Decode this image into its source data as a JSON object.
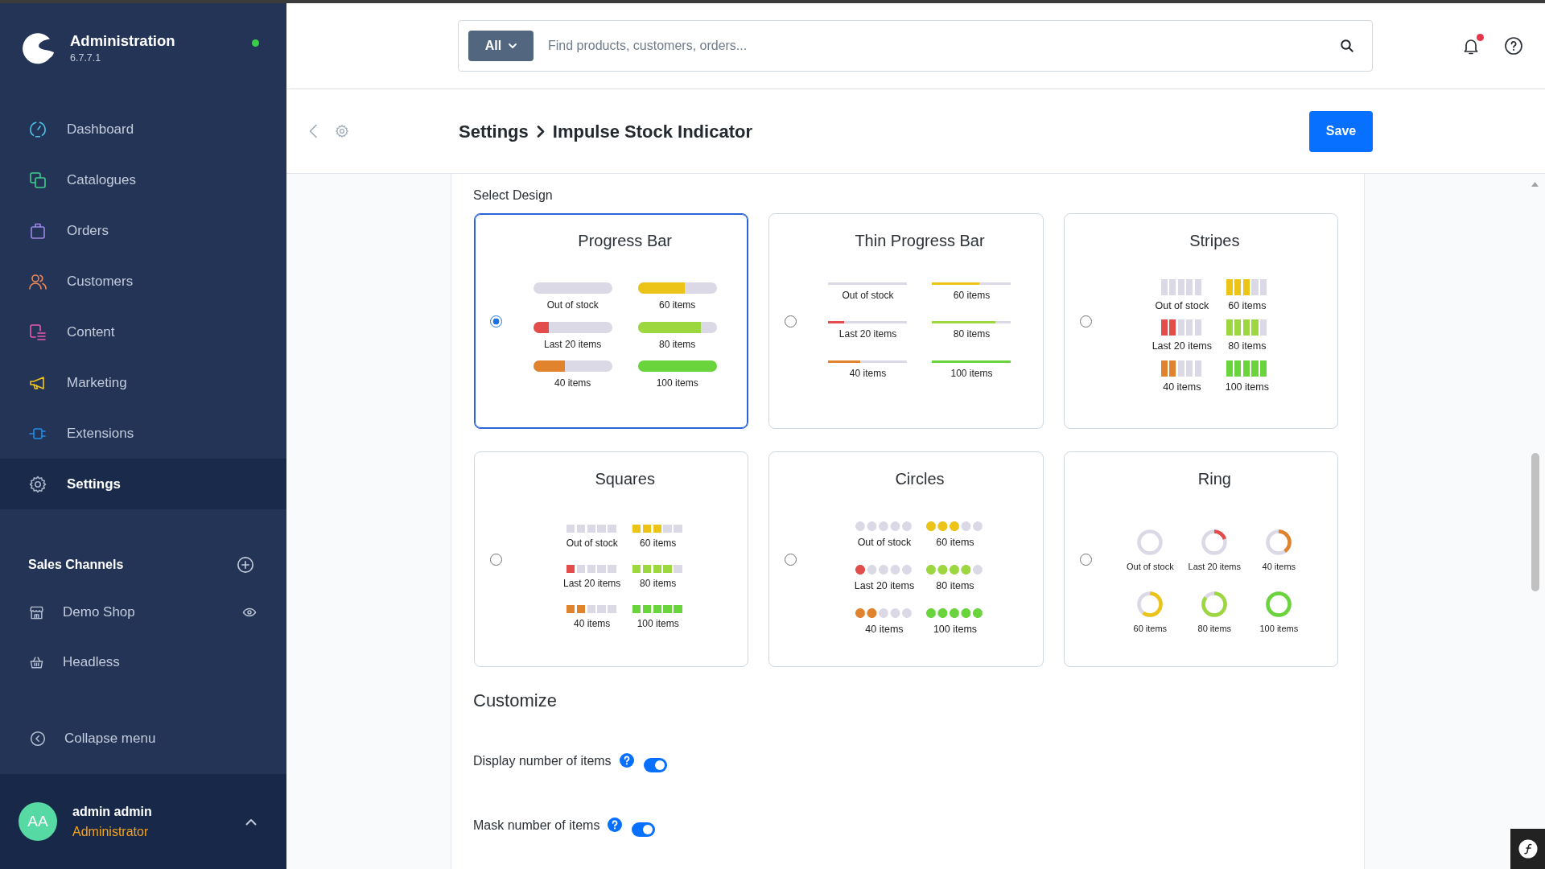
{
  "sidebar": {
    "title": "Administration",
    "version": "6.7.7.1",
    "online": true,
    "items": [
      {
        "label": "Dashboard",
        "selected": false
      },
      {
        "label": "Catalogues",
        "selected": false
      },
      {
        "label": "Orders",
        "selected": false
      },
      {
        "label": "Customers",
        "selected": false
      },
      {
        "label": "Content",
        "selected": false
      },
      {
        "label": "Marketing",
        "selected": false
      },
      {
        "label": "Extensions",
        "selected": false
      },
      {
        "label": "Settings",
        "selected": true
      }
    ],
    "sales_channels": {
      "title": "Sales Channels",
      "items": [
        {
          "label": "Demo Shop",
          "kind": "storefront"
        },
        {
          "label": "Headless",
          "kind": "headless"
        }
      ]
    },
    "collapse_label": "Collapse menu",
    "user": {
      "initials": "AA",
      "name": "admin admin",
      "role": "Administrator"
    }
  },
  "header": {
    "search": {
      "scope": "All",
      "placeholder": "Find products, customers, orders..."
    },
    "notifications": {
      "unread": true
    }
  },
  "smart_bar": {
    "breadcrumb": [
      "Settings",
      "Impulse Stock Indicator"
    ],
    "save_label": "Save"
  },
  "design": {
    "label": "Select Design",
    "options": [
      {
        "title": "Progress Bar",
        "kind": "progress",
        "selected": true,
        "samples": [
          {
            "label": "Out of stock",
            "level": 0
          },
          {
            "label": "60 items",
            "level": 0.6,
            "color": "#ecc417"
          },
          {
            "label": "Last 20 items",
            "level": 0.2,
            "color": "#e24c4b"
          },
          {
            "label": "80 items",
            "level": 0.8,
            "color": "#9dd73f"
          },
          {
            "label": "40 items",
            "level": 0.4,
            "color": "#e0832c"
          },
          {
            "label": "100 items",
            "level": 1,
            "color": "#6ad43c"
          }
        ]
      },
      {
        "title": "Thin Progress Bar",
        "kind": "thin",
        "selected": false,
        "samples": [
          {
            "label": "Out of stock",
            "level": 0
          },
          {
            "label": "60 items",
            "level": 0.6,
            "color": "#ecc417"
          },
          {
            "label": "Last 20 items",
            "level": 0.2,
            "color": "#e24c4b"
          },
          {
            "label": "80 items",
            "level": 0.8,
            "color": "#9dd73f"
          },
          {
            "label": "40 items",
            "level": 0.4,
            "color": "#e0832c"
          },
          {
            "label": "100 items",
            "level": 1,
            "color": "#6ad43c"
          }
        ]
      },
      {
        "title": "Stripes",
        "kind": "stripes",
        "selected": false,
        "samples": [
          {
            "label": "Out of stock",
            "level": 0
          },
          {
            "label": "60 items",
            "level": 0.6,
            "color": "#ecc417"
          },
          {
            "label": "Last 20 items",
            "level": 0.4,
            "color": "#e24c4b"
          },
          {
            "label": "80 items",
            "level": 0.8,
            "color": "#9dd73f"
          },
          {
            "label": "40 items",
            "level": 0.4,
            "color": "#e0832c"
          },
          {
            "label": "100 items",
            "level": 1,
            "color": "#6ad43c"
          }
        ]
      },
      {
        "title": "Squares",
        "kind": "squares",
        "selected": false,
        "samples": [
          {
            "label": "Out of stock",
            "level": 0
          },
          {
            "label": "60 items",
            "level": 0.6,
            "color": "#ecc417"
          },
          {
            "label": "Last 20 items",
            "level": 0.2,
            "color": "#e24c4b"
          },
          {
            "label": "80 items",
            "level": 0.8,
            "color": "#9dd73f"
          },
          {
            "label": "40 items",
            "level": 0.4,
            "color": "#e0832c"
          },
          {
            "label": "100 items",
            "level": 1,
            "color": "#6ad43c"
          }
        ]
      },
      {
        "title": "Circles",
        "kind": "circles",
        "selected": false,
        "samples": [
          {
            "label": "Out of stock",
            "level": 0
          },
          {
            "label": "60 items",
            "level": 0.6,
            "color": "#ecc417"
          },
          {
            "label": "Last 20 items",
            "level": 0.2,
            "color": "#e24c4b"
          },
          {
            "label": "80 items",
            "level": 0.8,
            "color": "#9dd73f"
          },
          {
            "label": "40 items",
            "level": 0.4,
            "color": "#e0832c"
          },
          {
            "label": "100 items",
            "level": 1,
            "color": "#6ad43c"
          }
        ]
      },
      {
        "title": "Ring",
        "kind": "ring",
        "selected": false,
        "samples": [
          {
            "label": "Out of stock",
            "level": 0
          },
          {
            "label": "Last 20 items",
            "level": 0.2,
            "color": "#e24c4b"
          },
          {
            "label": "40 items",
            "level": 0.4,
            "color": "#e0832c"
          },
          {
            "label": "60 items",
            "level": 0.6,
            "color": "#ecc417"
          },
          {
            "label": "80 items",
            "level": 0.85,
            "color": "#9dd73f"
          },
          {
            "label": "100 items",
            "level": 1,
            "color": "#6ad43c"
          }
        ]
      }
    ]
  },
  "customize": {
    "title": "Customize",
    "options": [
      {
        "label": "Display number of items",
        "on": true
      },
      {
        "label": "Mask number of items",
        "on": true
      }
    ]
  }
}
